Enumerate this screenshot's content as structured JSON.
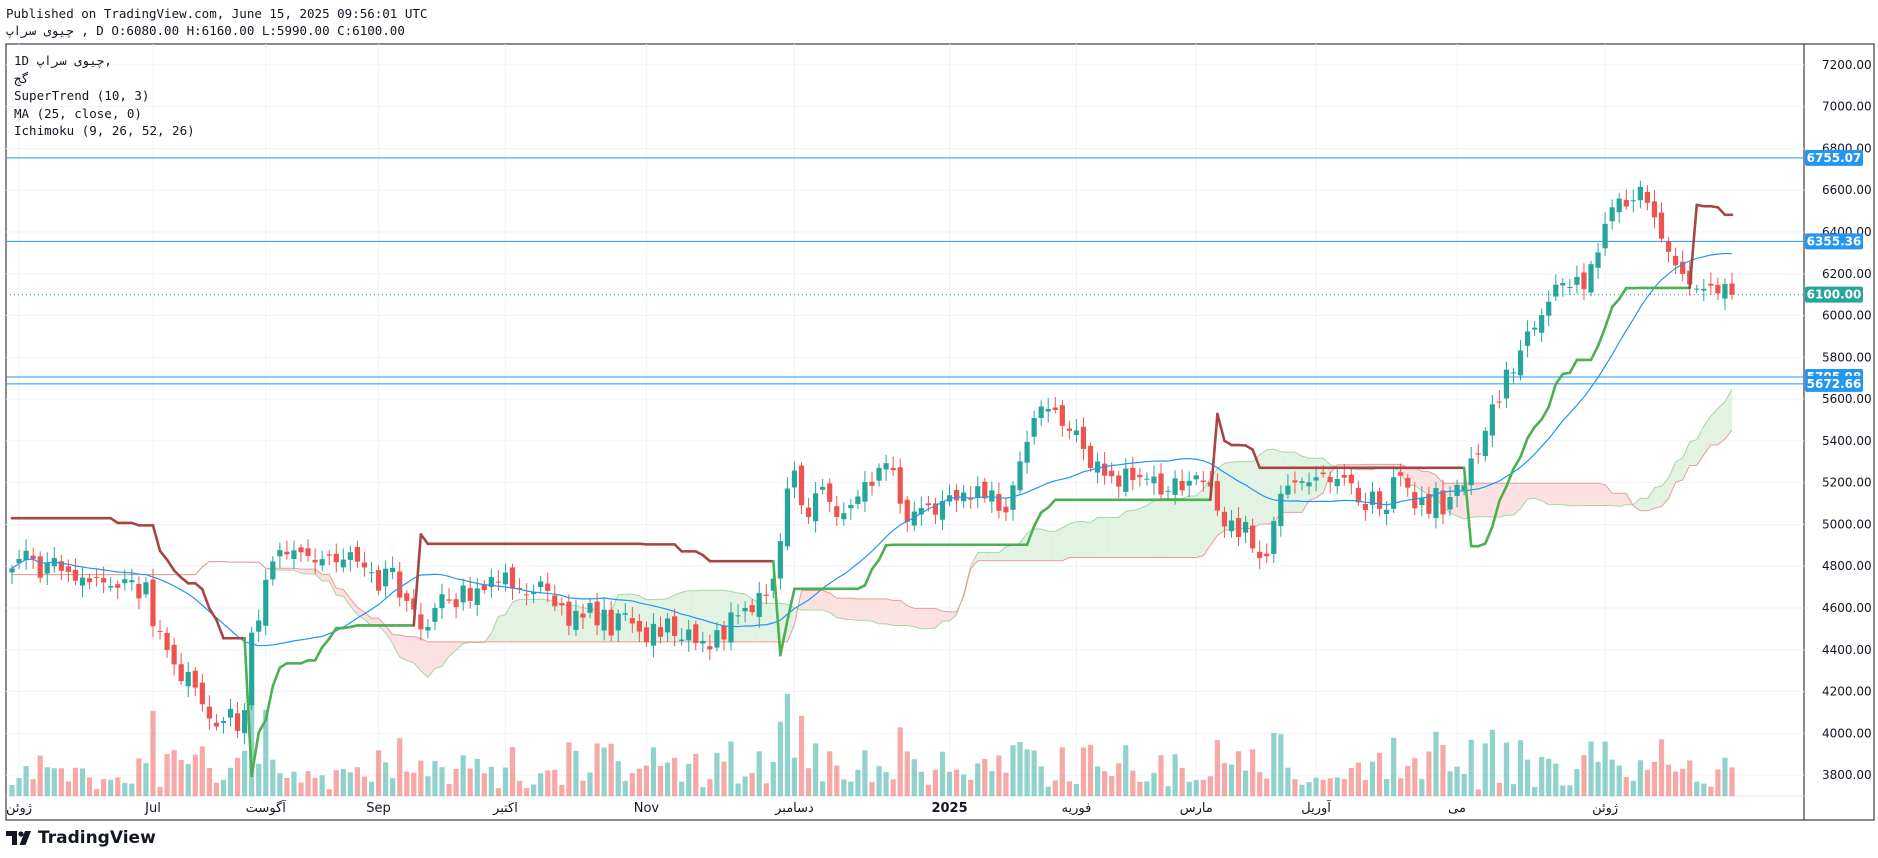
{
  "header": {
    "published": "Published on TradingView.com, June 15, 2025 09:56:01 UTC",
    "ohlc": "چیوی سراپ , D O:6080.00 H:6160.00 L:5990.00 C:6100.00"
  },
  "legend": {
    "line1": "1D چیوی سراپ,",
    "line2": "گج",
    "supertrend": "SuperTrend (10, 3)",
    "ma": "MA (25, close, 0)",
    "ichimoku": "Ichimoku (9, 26, 52, 26)"
  },
  "brand": {
    "name": "TradingView"
  },
  "colors": {
    "up": "#26a69a",
    "down": "#ef5350",
    "ma": "#2196f3",
    "supertrend_up": "#4caf50",
    "supertrend_down": "#a84444",
    "cloud_bull": "#e3f3e3",
    "cloud_bear": "#fbe1e1",
    "hline": "#2196f3",
    "last_price": "#26a69a"
  },
  "chart_data": {
    "type": "candlestick",
    "y_range": [
      3700,
      7300
    ],
    "y_ticks": [
      3800,
      4000,
      4200,
      4400,
      4600,
      4800,
      5000,
      5200,
      5400,
      5600,
      5800,
      6000,
      6200,
      6400,
      6600,
      6800,
      7000,
      7200
    ],
    "x_ticks": [
      {
        "label": "ژوئن",
        "i": 1
      },
      {
        "label": "Jul",
        "i": 20
      },
      {
        "label": "آگوست",
        "i": 36
      },
      {
        "label": "Sep",
        "i": 52
      },
      {
        "label": "اکتبر",
        "i": 70
      },
      {
        "label": "Nov",
        "i": 90
      },
      {
        "label": "دسامبر",
        "i": 111
      },
      {
        "label": "2025",
        "i": 133
      },
      {
        "label": "فوریه",
        "i": 151
      },
      {
        "label": "مارس",
        "i": 168
      },
      {
        "label": "آوریل",
        "i": 185
      },
      {
        "label": "می",
        "i": 205
      },
      {
        "label": "ژوئن",
        "i": 226
      }
    ],
    "horizontal_lines": [
      {
        "value": 6755.07,
        "label": "6755.07"
      },
      {
        "value": 6355.36,
        "label": "6355.36"
      },
      {
        "value": 5705.98,
        "label": "5705.98"
      },
      {
        "value": 5672.66,
        "label": "5672.66"
      }
    ],
    "last_price": {
      "value": 6100.0,
      "label": "6100.00"
    },
    "close": [
      4790,
      4835,
      4874,
      4835,
      4745,
      4817,
      4839,
      4778,
      4773,
      4731,
      4746,
      4724,
      4746,
      4722,
      4705,
      4697,
      4738,
      4733,
      4646,
      4723,
      4513,
      4488,
      4399,
      4330,
      4250,
      4294,
      4219,
      4139,
      4071,
      4033,
      4059,
      4117,
      4012,
      4111,
      4482,
      4540,
      4735,
      4823,
      4877,
      4857,
      4876,
      4867,
      4849,
      4818,
      4834,
      4851,
      4819,
      4832,
      4867,
      4822,
      4794,
      4771,
      4683,
      4788,
      4792,
      4650,
      4634,
      4593,
      4498,
      4509,
      4600,
      4666,
      4635,
      4604,
      4708,
      4634,
      4694,
      4686,
      4748,
      4723,
      4770,
      4693,
      4690,
      4663,
      4676,
      4727,
      4682,
      4608,
      4613,
      4515,
      4586,
      4554,
      4624,
      4517,
      4592,
      4468,
      4574,
      4575,
      4526,
      4487,
      4437,
      4524,
      4462,
      4550,
      4466,
      4449,
      4497,
      4432,
      4442,
      4402,
      4494,
      4449,
      4579,
      4565,
      4600,
      4580,
      4672,
      4658,
      4740,
      4920,
      5172,
      5258,
      5092,
      5036,
      5149,
      5180,
      5108,
      5036,
      5054,
      5093,
      5134,
      5203,
      5185,
      5271,
      5293,
      5260,
      5099,
      5013,
      5062,
      5079,
      5092,
      5047,
      5112,
      5140,
      5115,
      5153,
      5119,
      5183,
      5125,
      5163,
      5065,
      5058,
      5187,
      5302,
      5395,
      5510,
      5565,
      5553,
      5548,
      5472,
      5448,
      5450,
      5361,
      5270,
      5301,
      5233,
      5231,
      5181,
      5268,
      5213,
      5226,
      5219,
      5229,
      5143,
      5161,
      5221,
      5163,
      5209,
      5235,
      5203,
      5182,
      5066,
      4991,
      5019,
      4940,
      5012,
      4885,
      4839,
      4848,
      5016,
      5147,
      5186,
      5201,
      5207,
      5202,
      5226,
      5241,
      5202,
      5218,
      5224,
      5197,
      5106,
      5069,
      5157,
      5075,
      5070,
      5226,
      5233,
      5176,
      5077,
      5129,
      5051,
      5174,
      5048,
      5131,
      5189,
      5187,
      5316,
      5335,
      5448,
      5575,
      5584,
      5741,
      5728,
      5833,
      5924,
      5942,
      6002,
      6066,
      6148,
      6156,
      6137,
      6185,
      6126,
      6246,
      6302,
      6439,
      6518,
      6560,
      6522,
      6552,
      6616,
      6540,
      6470,
      6368,
      6305,
      6240,
      6199,
      6149,
      6129,
      6128,
      6143,
      6106,
      6151,
      6100
    ],
    "n_bars": 270,
    "bar_spacing_px": 7.05,
    "first_bar_x": 12
  }
}
